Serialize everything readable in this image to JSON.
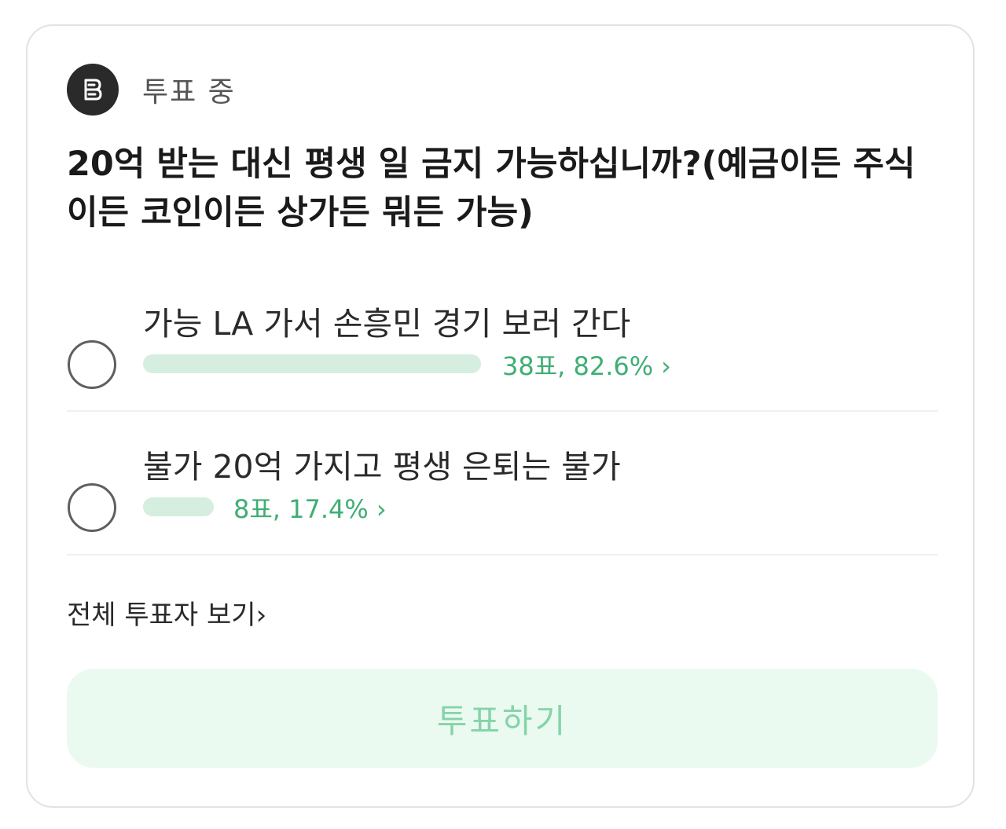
{
  "poll": {
    "status": "투표 중",
    "badge_icon": "poll-badge-icon",
    "question": "20억 받는 대신 평생 일 금지 가능하십니까?(예금이든 주식이든 코인이든 상가든 뭐든 가능)",
    "options": [
      {
        "label": "가능 LA 가서 손흥민 경기 보러 간다",
        "result": "38표, 82.6%",
        "votes": 38,
        "percent": 82.6
      },
      {
        "label": "불가 20억 가지고 평생 은퇴는 불가",
        "result": "8표, 17.4%",
        "votes": 8,
        "percent": 17.4
      }
    ],
    "chevron": "›",
    "view_voters": "전체 투표자 보기",
    "vote_button": "투표하기"
  },
  "colors": {
    "accent": "#3fae74",
    "bar_fill": "#d6eedf",
    "button_bg": "#eafaf1",
    "button_text": "#86d3a8"
  }
}
